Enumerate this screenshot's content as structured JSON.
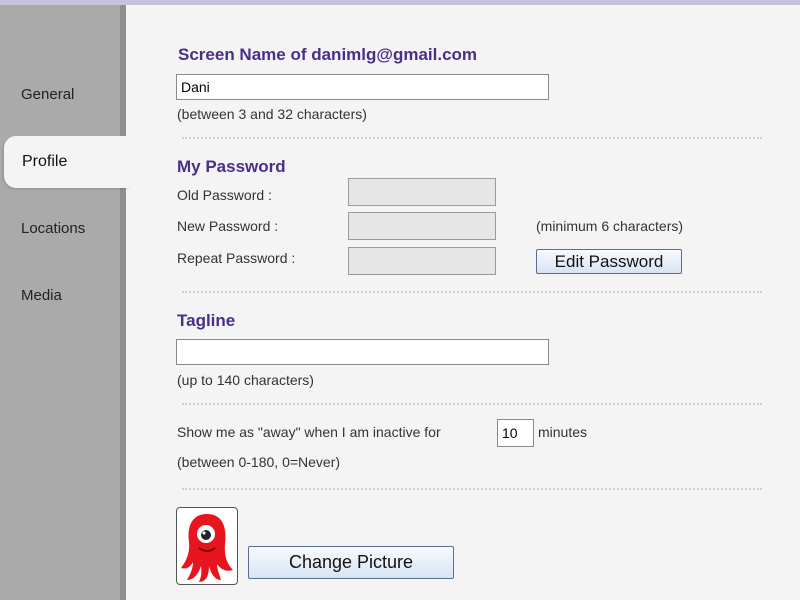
{
  "sidebar": {
    "items": [
      {
        "label": "General"
      },
      {
        "label": "Profile"
      },
      {
        "label": "Locations"
      },
      {
        "label": "Media"
      }
    ],
    "active": "Profile"
  },
  "screen_name": {
    "title": "Screen Name of  danimlg@gmail.com",
    "value": "Dani",
    "hint": "(between 3 and 32 characters)"
  },
  "password": {
    "title": "My Password",
    "old_label": "Old Password :",
    "new_label": "New Password :",
    "repeat_label": "Repeat Password :",
    "min_hint": "(minimum 6 characters)",
    "edit_button": "Edit Password"
  },
  "tagline": {
    "title": "Tagline",
    "value": "",
    "hint": "(up to 140 characters)"
  },
  "away": {
    "prefix": "Show me as \"away\" when I am inactive for",
    "value": "10",
    "suffix": "minutes",
    "hint": "(between 0-180, 0=Never)"
  },
  "picture": {
    "icon": "red-octopus-avatar",
    "change_button": "Change Picture"
  },
  "colors": {
    "accent": "#4a2f8a",
    "sidebar": "#aaaaaa",
    "background": "#f4f4f4",
    "avatar": "#e8141e"
  }
}
